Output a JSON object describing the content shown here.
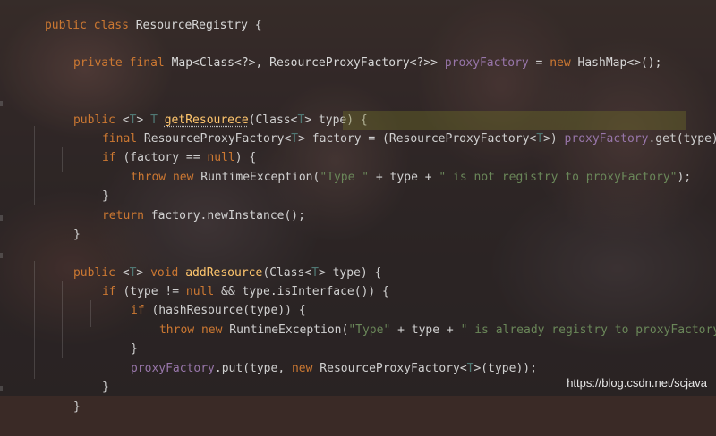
{
  "code": {
    "l1": [
      "public",
      " class ",
      "ResourceRegistry",
      " {"
    ],
    "l3": [
      "private",
      " ",
      "final",
      " ",
      "Map<Class<?>, ResourceProxyFactory<?>>",
      " ",
      "proxyFactory",
      " = ",
      "new",
      " ",
      "HashMap<>();"
    ],
    "l5": [
      "public",
      " <",
      "T",
      "> ",
      "T",
      " ",
      "getResourece",
      "(Class<",
      "T",
      "> type) {"
    ],
    "l6": [
      "final",
      " ResourceProxyFactory<",
      "T",
      "> factory = ",
      "(ResourceProxyFactory<",
      "T",
      ">)",
      " ",
      "proxyFactory",
      ".get(type)",
      ";"
    ],
    "l7": [
      "if",
      " (factory == ",
      "null",
      ") {"
    ],
    "l8": [
      "throw",
      " ",
      "new",
      " RuntimeException(",
      "\"Type \"",
      " + type + ",
      "\" is not registry to proxyFactory\"",
      ");"
    ],
    "l9": [
      "}"
    ],
    "l10": [
      "return",
      " factory.newInstance();"
    ],
    "l11": [
      "}"
    ],
    "l13": [
      "public",
      " <",
      "T",
      "> ",
      "void",
      " ",
      "addResource",
      "(Class<",
      "T",
      "> type) {"
    ],
    "l14": [
      "if",
      " (type != ",
      "null",
      " && type.isInterface()) {"
    ],
    "l15": [
      "if",
      " (hashResource(type)) {"
    ],
    "l16": [
      "throw",
      " ",
      "new",
      " RuntimeException(",
      "\"Type\"",
      " + type + ",
      "\" is already registry to proxyFactory\"",
      ");"
    ],
    "l17": [
      "}"
    ],
    "l18": [
      "proxyFactory",
      ".put(type, ",
      "new",
      " ResourceProxyFactory<",
      "T",
      ">(type));"
    ],
    "l19": [
      "}"
    ],
    "l20": [
      "}"
    ]
  },
  "watermark": "https://blog.csdn.net/scjava",
  "colors": {
    "keyword": "#cc7832",
    "function": "#ffc66d",
    "field": "#9876aa",
    "string": "#6a8759",
    "typeParam": "#507874",
    "text": "#d0d0d0"
  }
}
